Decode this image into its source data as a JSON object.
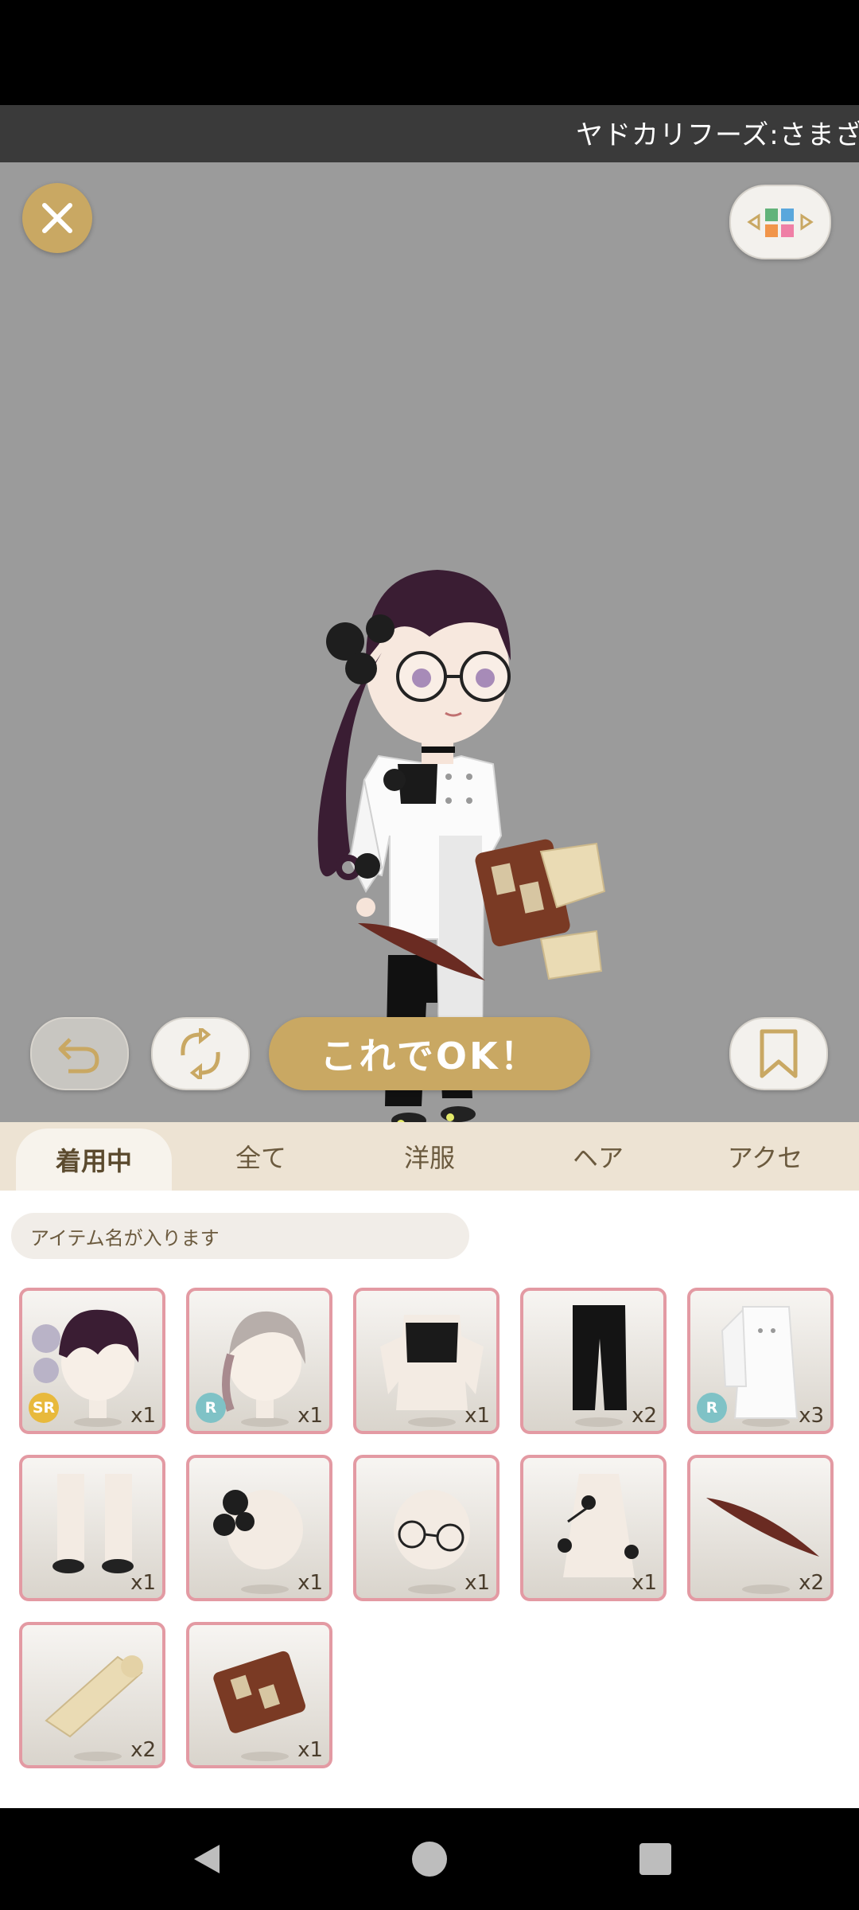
{
  "ticker": {
    "text": "ヤドカリフーズ:さまざ"
  },
  "stage": {
    "close_icon": "close-icon",
    "layout_icon": "layout-toggle-icon",
    "ok_label": "これでOK！"
  },
  "tabs": [
    {
      "label": "着用中",
      "active": true
    },
    {
      "label": "全て",
      "active": false
    },
    {
      "label": "洋服",
      "active": false
    },
    {
      "label": "ヘア",
      "active": false
    },
    {
      "label": "アクセ",
      "active": false
    }
  ],
  "search": {
    "placeholder": "アイテム名が入ります"
  },
  "items": [
    {
      "name": "hair-front",
      "qty": "x1",
      "rarity": "SR"
    },
    {
      "name": "hair-braid",
      "qty": "x1",
      "rarity": "R"
    },
    {
      "name": "black-crop-top",
      "qty": "x1",
      "rarity": ""
    },
    {
      "name": "black-pants",
      "qty": "x2",
      "rarity": ""
    },
    {
      "name": "white-chef-coat",
      "qty": "x3",
      "rarity": "R"
    },
    {
      "name": "white-socks-shoes",
      "qty": "x1",
      "rarity": ""
    },
    {
      "name": "black-rose-hairpin",
      "qty": "x1",
      "rarity": ""
    },
    {
      "name": "round-glasses",
      "qty": "x1",
      "rarity": ""
    },
    {
      "name": "rose-vine-accessory",
      "qty": "x1",
      "rarity": ""
    },
    {
      "name": "feather-quill",
      "qty": "x2",
      "rarity": ""
    },
    {
      "name": "scroll-bundle",
      "qty": "x2",
      "rarity": ""
    },
    {
      "name": "leather-book",
      "qty": "x1",
      "rarity": ""
    }
  ],
  "colors": {
    "accent": "#c9a863",
    "item_border": "#e39aa3",
    "stage_bg": "#9b9b9b",
    "tab_bg": "#ede3d3"
  }
}
